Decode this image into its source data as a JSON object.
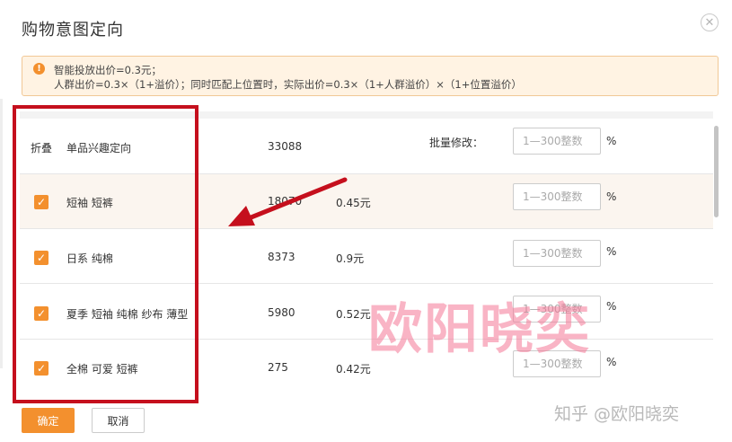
{
  "dialog": {
    "title": "购物意图定向",
    "close_glyph": "✕"
  },
  "notice": {
    "icon": "warning-icon",
    "line1": "智能投放出价=0.3元；",
    "line2": "人群出价=0.3×（1+溢价）；同时匹配上位置时，实际出价=0.3×（1+人群溢价）×（1+位置溢价）"
  },
  "header_row": {
    "fold": "折叠",
    "label": "单品兴趣定向",
    "count": "33088",
    "batch_label": "批量修改：",
    "input_placeholder": "1—300整数",
    "percent": "%"
  },
  "rows": [
    {
      "checked": true,
      "keywords": "短袖 短裤",
      "count": "18070",
      "price": "0.45元",
      "input_placeholder": "1—300整数",
      "percent": "%"
    },
    {
      "checked": true,
      "keywords": "日系 纯棉",
      "count": "8373",
      "price": "0.9元",
      "input_placeholder": "1—300整数",
      "percent": "%"
    },
    {
      "checked": true,
      "keywords": "夏季 短袖 纯棉 纱布 薄型",
      "count": "5980",
      "price": "0.52元",
      "input_placeholder": "1—300整数",
      "percent": "%"
    },
    {
      "checked": true,
      "keywords": "全棉 可爱 短裤",
      "count": "275",
      "price": "0.42元",
      "input_placeholder": "1—300整数",
      "percent": "%"
    }
  ],
  "check_glyph": "✓",
  "footer": {
    "confirm": "确定",
    "cancel": "取消"
  },
  "watermark": "欧阳晓奕",
  "zhihu_mark": "知乎 @欧阳晓奕",
  "colors": {
    "accent": "#f3902e",
    "annotation_red": "#c50f1d",
    "notice_bg": "#fff3e3",
    "highlight_row": "#fbf5ef"
  }
}
